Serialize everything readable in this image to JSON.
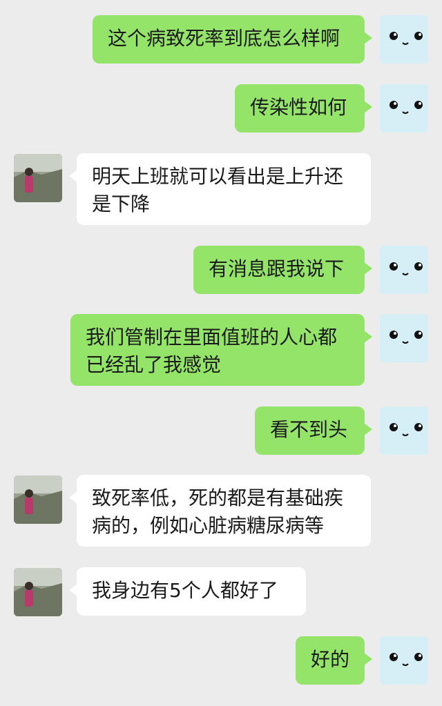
{
  "messages": [
    {
      "side": "me",
      "text": "这个病致死率到底怎么样啊"
    },
    {
      "side": "me",
      "text": "传染性如何"
    },
    {
      "side": "them",
      "text": "明天上班就可以看出是上升还是下降"
    },
    {
      "side": "me",
      "text": "有消息跟我说下"
    },
    {
      "side": "me",
      "text": "我们管制在里面值班的人心都已经乱了我感觉"
    },
    {
      "side": "me",
      "text": "看不到头"
    },
    {
      "side": "them",
      "text": "致死率低，死的都是有基础疾病的，例如心脏病糖尿病等"
    },
    {
      "side": "them",
      "text": "我身边有5个人都好了"
    },
    {
      "side": "me",
      "text": "好的"
    }
  ],
  "colors": {
    "background": "#ececec",
    "my_bubble": "#95e46a",
    "their_bubble": "#ffffff",
    "my_avatar_bg": "#d6eef5"
  },
  "icons": {
    "my_avatar": "cute-face-avatar-icon",
    "their_avatar": "person-photo-avatar"
  }
}
